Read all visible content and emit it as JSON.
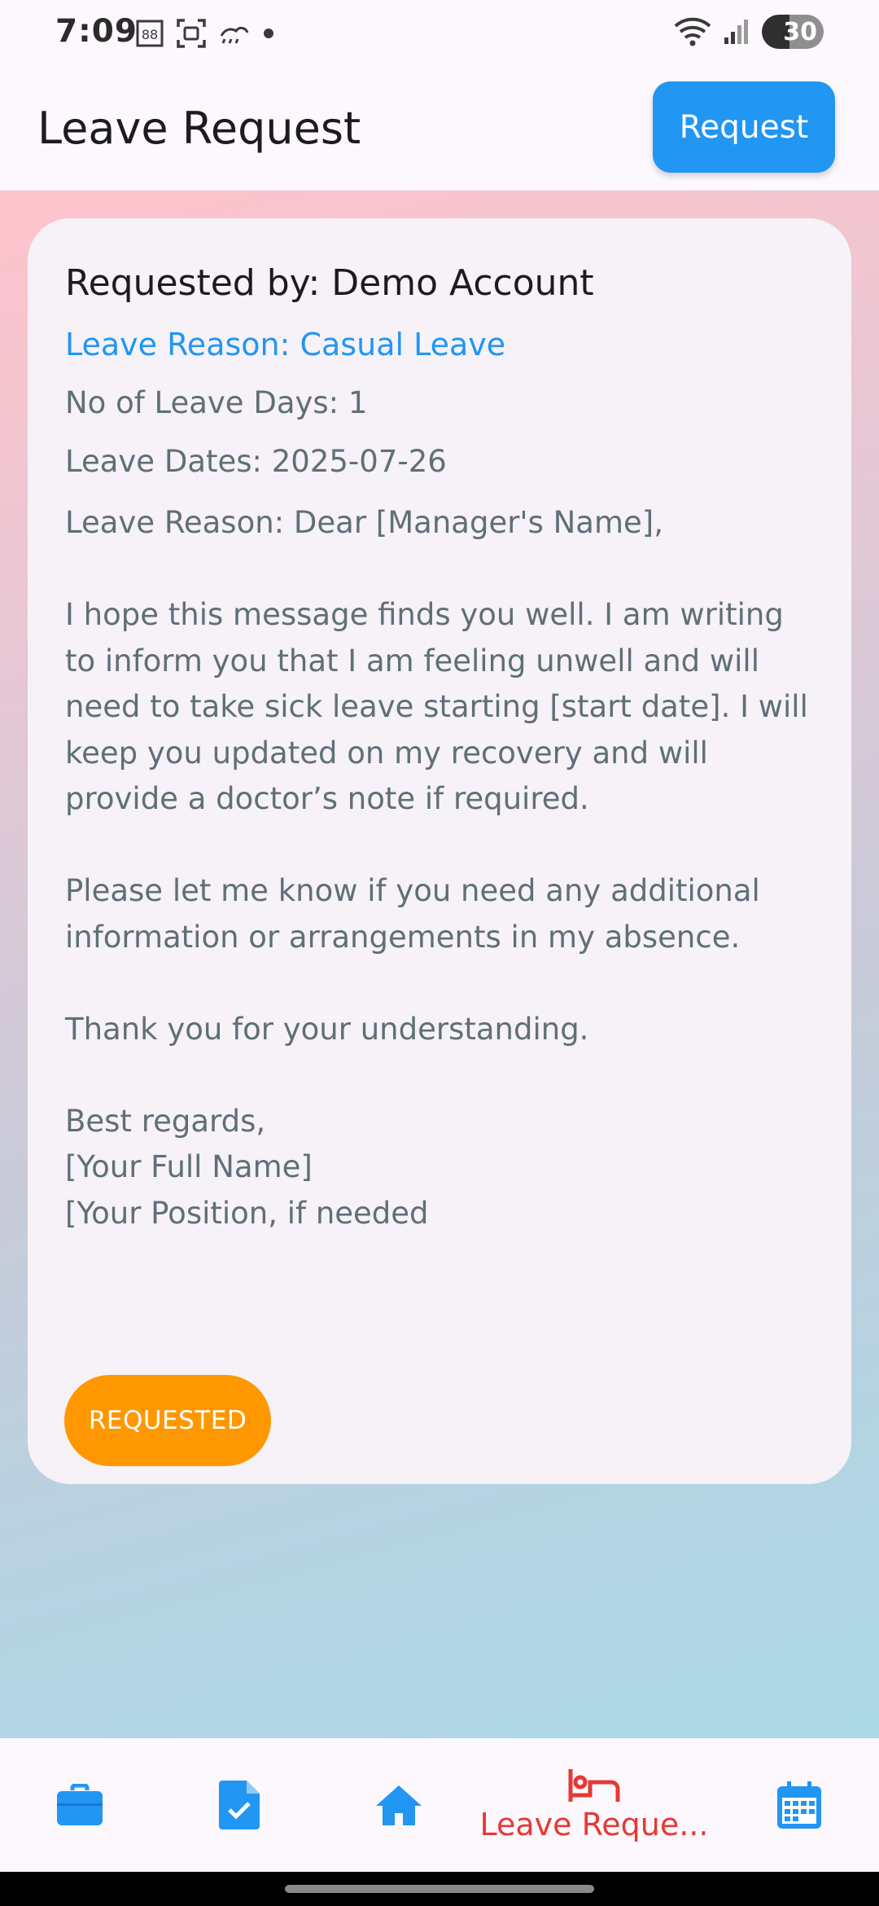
{
  "status_bar": {
    "time": "7:09",
    "battery": "30",
    "icons_left": [
      "sim-icon",
      "screenshot-icon",
      "weather-icon",
      "dot-icon"
    ],
    "icons_right": [
      "wifi-icon",
      "signal-icon",
      "battery-icon"
    ]
  },
  "app_bar": {
    "title": "Leave Request",
    "request_label": "Request"
  },
  "card": {
    "requested_by": "Requested by: Demo Account",
    "reason_type": "Leave Reason: Casual Leave",
    "leave_days": "No of Leave Days: 1",
    "leave_dates": "Leave Dates: 2025-07-26",
    "message": "Leave Reason: Dear [Manager's Name],\n\nI hope this message finds you well. I am writing to inform you that I am feeling unwell and will need to take sick leave starting [start date]. I will keep you updated on my recovery and will provide a doctor’s note if required.\n\nPlease let me know if you need any additional information or arrangements in my absence.\n\nThank you for your understanding.\n\nBest regards,\n[Your Full Name]\n[Your Position, if needed",
    "status": "REQUESTED"
  },
  "bottom_nav": {
    "items": [
      {
        "icon": "briefcase-icon",
        "label": ""
      },
      {
        "icon": "task-document-icon",
        "label": ""
      },
      {
        "icon": "home-icon",
        "label": ""
      },
      {
        "icon": "bed-icon",
        "label": "Leave Reque..."
      },
      {
        "icon": "calendar-icon",
        "label": ""
      }
    ],
    "active_index": 3
  },
  "colors": {
    "accent": "#2196f3",
    "active_nav": "#e53935",
    "status_requested": "#ff9800"
  }
}
